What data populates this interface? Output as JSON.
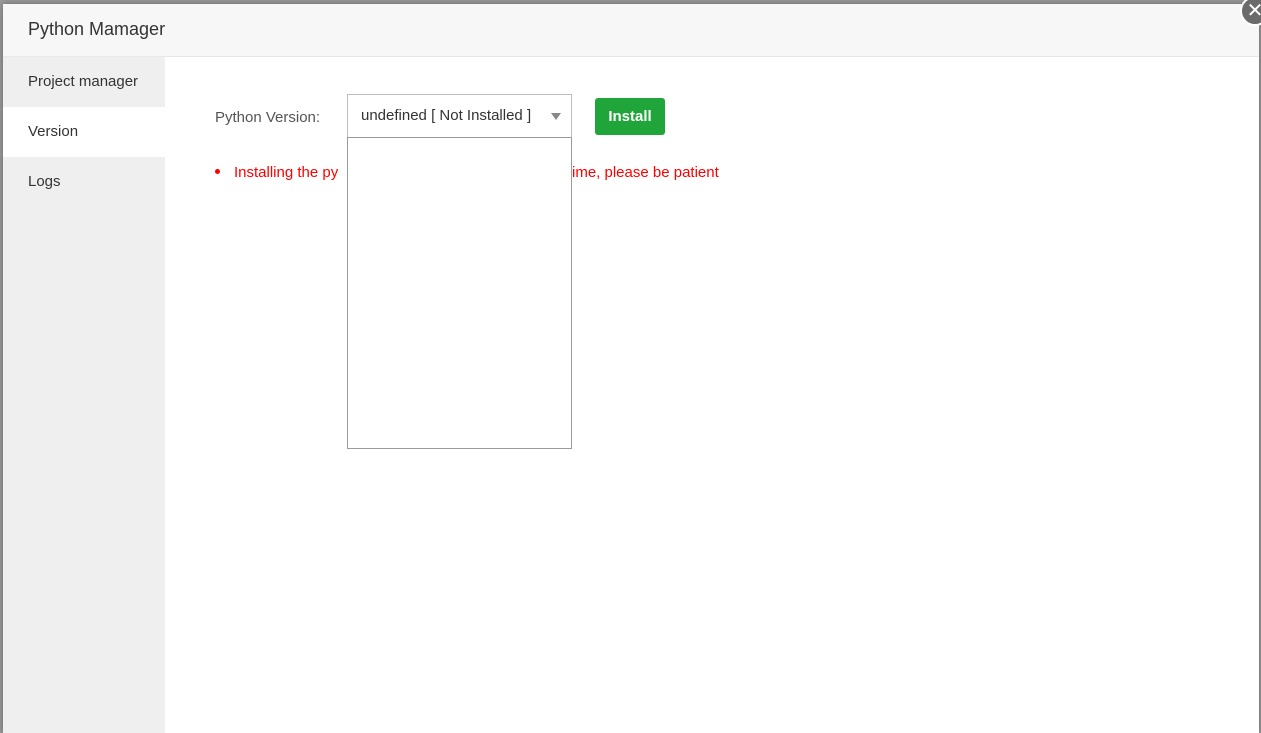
{
  "dialog": {
    "title": "Python Mamager",
    "close_symbol": "✕"
  },
  "sidebar": {
    "items": [
      {
        "label": "Project manager",
        "active": false
      },
      {
        "label": "Version",
        "active": true
      },
      {
        "label": "Logs",
        "active": false
      }
    ]
  },
  "version": {
    "label": "Python Version:",
    "selected_value": "undefined  [ Not Installed ]",
    "install_label": "Install"
  },
  "notice": {
    "visible_start": "Installing the py",
    "visible_end": "ime, please be patient"
  },
  "colors": {
    "accent": "#20a53a",
    "notice": "#ff0000"
  }
}
